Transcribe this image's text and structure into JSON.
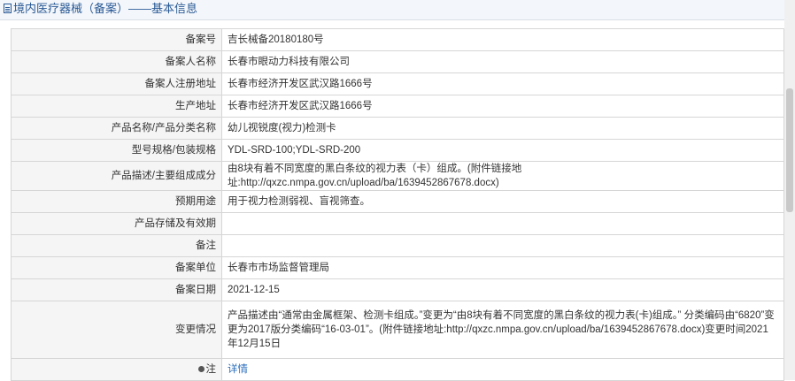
{
  "header": {
    "title": "境内医疗器械（备案）——基本信息",
    "icon": "document-icon"
  },
  "rows": [
    {
      "label": "备案号",
      "value": "吉长械备20180180号"
    },
    {
      "label": "备案人名称",
      "value": "长春市眼动力科技有限公司"
    },
    {
      "label": "备案人注册地址",
      "value": "长春市经济开发区武汉路1666号"
    },
    {
      "label": "生产地址",
      "value": "长春市经济开发区武汉路1666号"
    },
    {
      "label": "产品名称/产品分类名称",
      "value": "幼儿视锐度(视力)检测卡"
    },
    {
      "label": "型号规格/包装规格",
      "value": "YDL-SRD-100;YDL-SRD-200"
    },
    {
      "label": "产品描述/主要组成成分",
      "value": "由8块有着不同宽度的黑白条纹的视力表（卡）组成。(附件链接地址:http://qxzc.nmpa.gov.cn/upload/ba/1639452867678.docx)"
    },
    {
      "label": "预期用途",
      "value": "用于视力检测弱视、盲视筛查。"
    },
    {
      "label": "产品存储及有效期",
      "value": ""
    },
    {
      "label": "备注",
      "value": ""
    },
    {
      "label": "备案单位",
      "value": "长春市市场监督管理局"
    },
    {
      "label": "备案日期",
      "value": "2021-12-15"
    },
    {
      "label": "变更情况",
      "value": "产品描述由“通常由金属框架、检测卡组成。”变更为“由8块有着不同宽度的黑白条纹的视力表(卡)组成。” 分类编码由“6820”变更为2017版分类编码“16-03-01”。(附件链接地址:http://qxzc.nmpa.gov.cn/upload/ba/1639452867678.docx)变更时间2021年12月15日"
    }
  ],
  "note": {
    "label": "注",
    "link_text": "详情",
    "icon": "note-bullet-icon"
  }
}
